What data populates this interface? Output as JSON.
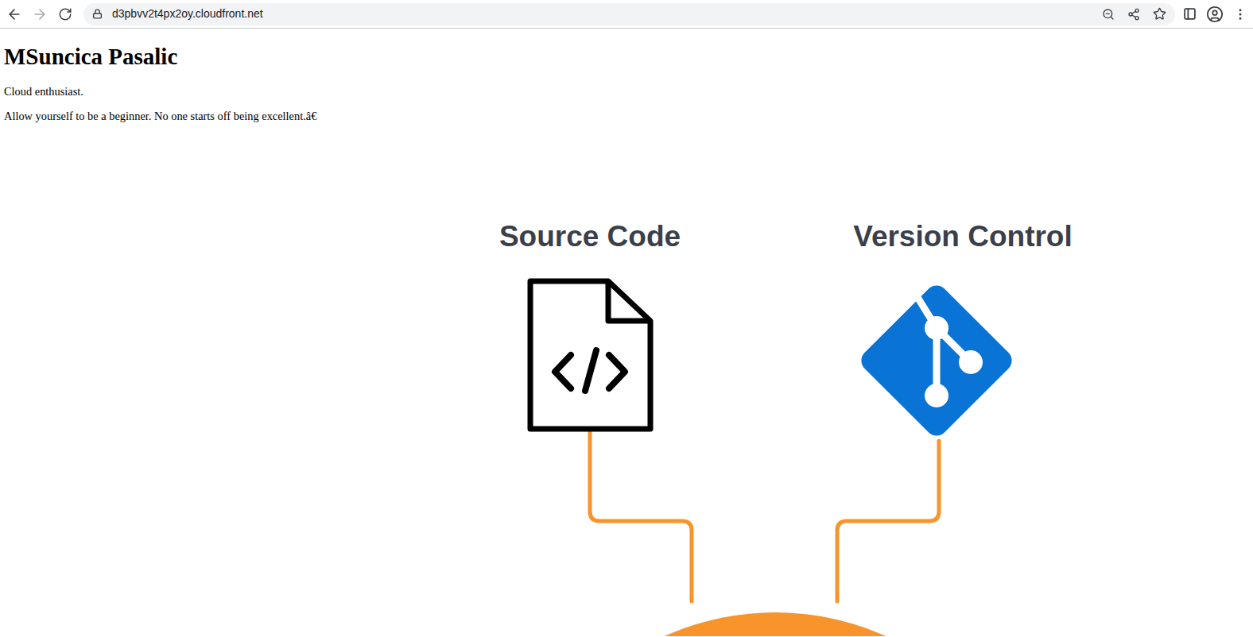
{
  "browser": {
    "url": "d3pbvv2t4px2oy.cloudfront.net",
    "back_enabled": true,
    "forward_enabled": false,
    "zoomed": true,
    "bookmarked": false
  },
  "page": {
    "heading": "MSuncica Pasalic",
    "paragraphs": [
      "Cloud enthusiast.",
      "Allow yourself to be a beginner. No one starts off being excellent.â€"
    ]
  },
  "diagram": {
    "nodes": [
      {
        "label": "Source Code"
      },
      {
        "label": "Version Control"
      }
    ]
  }
}
